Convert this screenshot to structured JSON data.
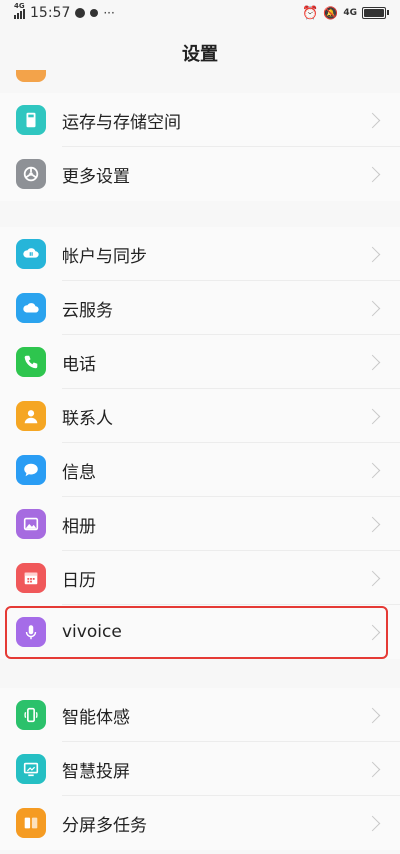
{
  "status": {
    "time": "15:57",
    "net_left": "4G",
    "net_right": "4G",
    "more": "···"
  },
  "title": "设置",
  "group1": [
    {
      "label": "运存与存储空间",
      "icon": "storage-icon",
      "color": "#2fc6c0"
    },
    {
      "label": "更多设置",
      "icon": "more-settings-icon",
      "color": "#8e9196"
    }
  ],
  "group2": [
    {
      "label": "帐户与同步",
      "icon": "account-sync-icon",
      "color": "#26b5d9"
    },
    {
      "label": "云服务",
      "icon": "cloud-icon",
      "color": "#2aa3ee"
    },
    {
      "label": "电话",
      "icon": "phone-icon",
      "color": "#2ec54e"
    },
    {
      "label": "联系人",
      "icon": "contacts-icon",
      "color": "#f5a623"
    },
    {
      "label": "信息",
      "icon": "message-icon",
      "color": "#2a9df4"
    },
    {
      "label": "相册",
      "icon": "album-icon",
      "color": "#a66be0"
    },
    {
      "label": "日历",
      "icon": "calendar-icon",
      "color": "#f0585a"
    },
    {
      "label": "vivoice",
      "icon": "microphone-icon",
      "color": "#a56ce8"
    }
  ],
  "group3": [
    {
      "label": "智能体感",
      "icon": "motion-icon",
      "color": "#2bc16b"
    },
    {
      "label": "智慧投屏",
      "icon": "screencast-icon",
      "color": "#25bfc3"
    },
    {
      "label": "分屏多任务",
      "icon": "split-screen-icon",
      "color": "#f59b22"
    }
  ]
}
